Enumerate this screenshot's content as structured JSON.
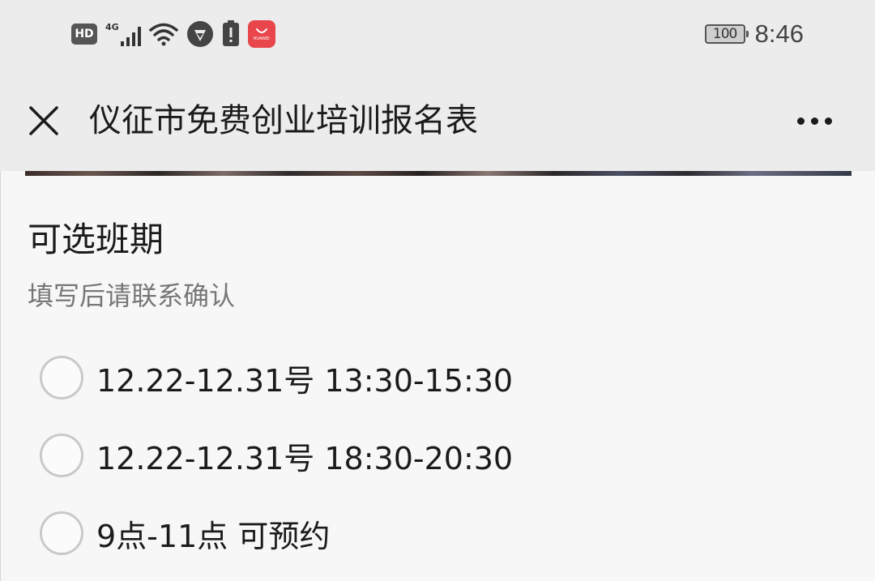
{
  "status_bar": {
    "hd_label": "HD",
    "network_label": "4G",
    "huawei_label": "HUAWEI",
    "battery_level": "100",
    "time": "8:46",
    "icons": [
      "hd-icon",
      "signal-icon",
      "wifi-icon",
      "app-notification-icon",
      "warning-icon",
      "huawei-store-icon",
      "battery-icon"
    ]
  },
  "header": {
    "title": "仪征市免费创业培训报名表",
    "close_icon": "close-icon",
    "more_icon": "more-icon"
  },
  "question": {
    "title": "可选班期",
    "description": "填写后请联系确认",
    "options": [
      {
        "label": "12.22-12.31号 13:30-15:30",
        "selected": false
      },
      {
        "label": "12.22-12.31号 18:30-20:30",
        "selected": false
      },
      {
        "label": "9点-11点 可预约",
        "selected": false
      }
    ]
  }
}
